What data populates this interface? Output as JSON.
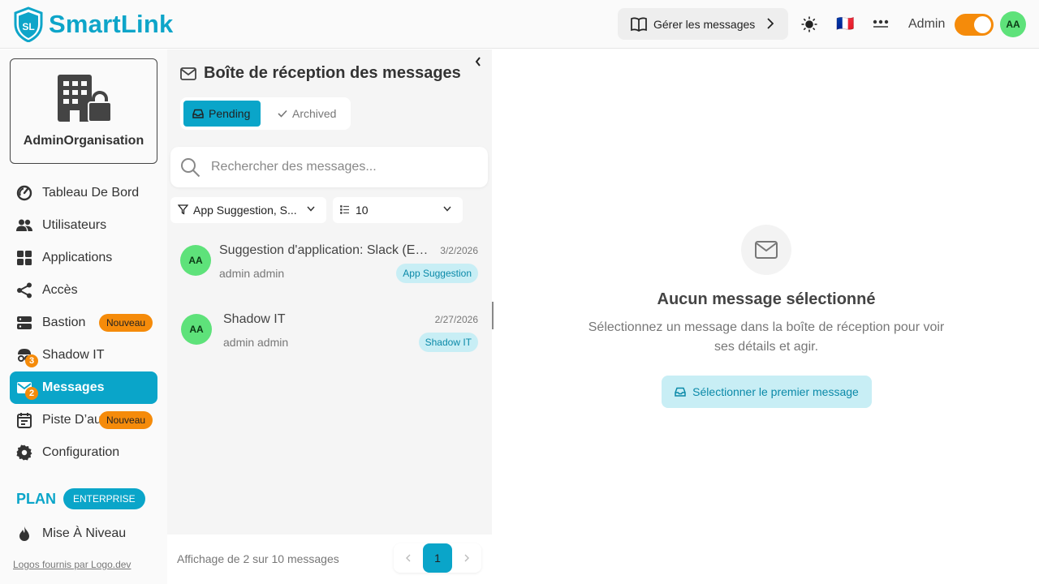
{
  "brand": {
    "name": "SmartLink",
    "logo_initials": "SL",
    "color": "#0ea5c9"
  },
  "header": {
    "manage_label": "Gérer les messages",
    "flag": "🇫🇷",
    "user_label": "Admin",
    "avatar_initials": "AA",
    "icons": [
      "book-open-icon",
      "chevron-right-icon",
      "sun-icon",
      "flag-fr-icon",
      "more-horizontal-icon"
    ]
  },
  "sidebar": {
    "org_name": "AdminOrganisation",
    "items": [
      {
        "label": "Tableau De Bord",
        "icon": "dashboard-gauge-icon"
      },
      {
        "label": "Utilisateurs",
        "icon": "users-icon"
      },
      {
        "label": "Applications",
        "icon": "apps-grid-icon"
      },
      {
        "label": "Accès",
        "icon": "share-icon"
      },
      {
        "label": "Bastion",
        "icon": "server-icon",
        "badge": "Nouveau"
      },
      {
        "label": "Shadow IT",
        "icon": "incognito-icon",
        "count": "3"
      },
      {
        "label": "Messages",
        "icon": "mail-icon",
        "count": "2",
        "active": true
      },
      {
        "label": "Piste D’audit",
        "icon": "calendar-list-icon",
        "badge": "Nouveau"
      },
      {
        "label": "Configuration",
        "icon": "gear-icon"
      }
    ],
    "plan_label": "PLAN",
    "plan_badge": "ENTERPRISE",
    "upgrade_label": "Mise À Niveau",
    "credits": "Logos fournis par Logo.dev"
  },
  "inbox": {
    "title": "Boîte de réception des messages",
    "tabs": {
      "pending": "Pending",
      "archived": "Archived"
    },
    "search_placeholder": "Rechercher des messages...",
    "filter_value": "App Suggestion, S...",
    "page_size": "10",
    "messages": [
      {
        "avatar": "AA",
        "subject": "Suggestion d'application: Slack (Entreprise)",
        "subject_display": "Suggestion d'application: Slack (E…",
        "date": "3/2/2026",
        "from": "admin admin",
        "tag": "App Suggestion"
      },
      {
        "avatar": "AA",
        "subject": "Shadow IT",
        "subject_display": "Shadow IT",
        "date": "2/27/2026",
        "from": "admin admin",
        "tag": "Shadow IT"
      }
    ],
    "footer_info": "Affichage de 2 sur 10 messages",
    "current_page": "1"
  },
  "detail": {
    "empty_title": "Aucun message sélectionné",
    "empty_subtitle": "Sélectionnez un message dans la boîte de réception pour voir ses détails et agir.",
    "select_first_label": "Sélectionner le premier message"
  },
  "colors": {
    "accent": "#0aa5c9",
    "orange": "#f58b0a",
    "avatar_green": "#5ee27a",
    "tag_bg": "#c8eef5"
  }
}
